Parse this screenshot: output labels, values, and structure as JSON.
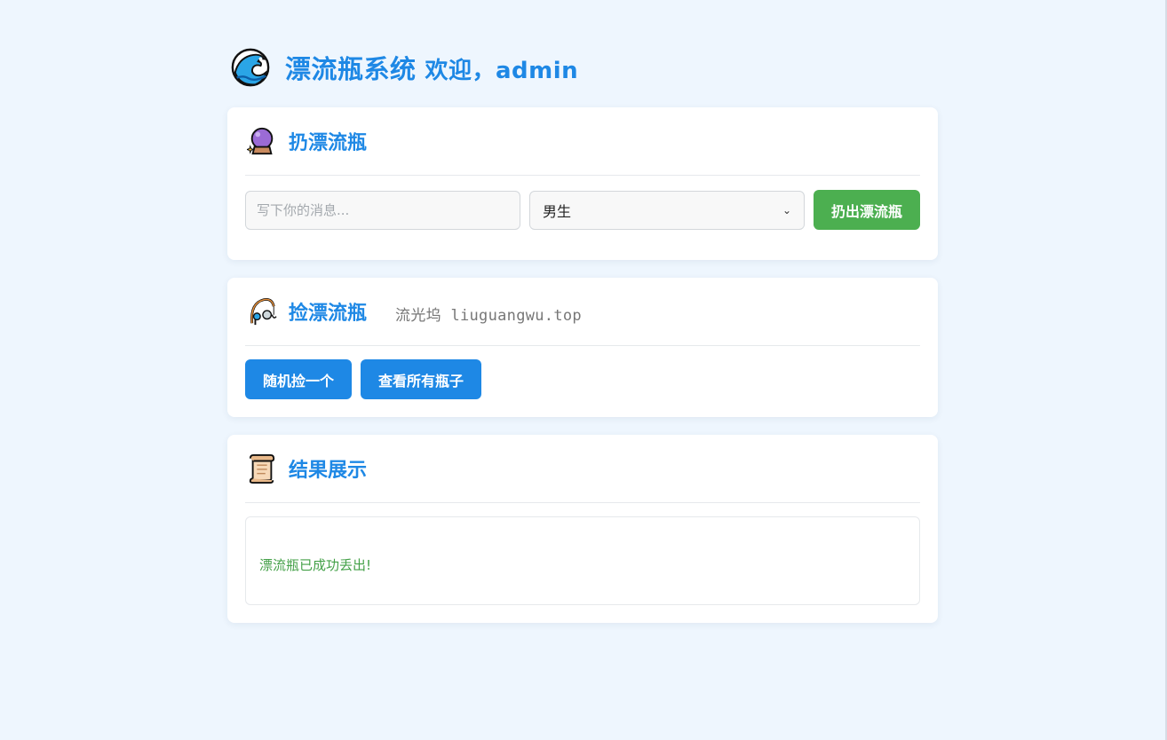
{
  "header": {
    "title": "漂流瓶系统",
    "welcome": "欢迎，admin",
    "logo_icon": "water-wave-icon"
  },
  "throw_section": {
    "title": "扔漂流瓶",
    "icon": "crystal-ball-icon",
    "message_placeholder": "写下你的消息...",
    "gender_selected": "男生",
    "submit_label": "扔出漂流瓶"
  },
  "pick_section": {
    "title": "捡漂流瓶",
    "icon": "fishing-pole-icon",
    "tagline": "流光坞 liuguangwu.top",
    "random_label": "随机捡一个",
    "view_all_label": "查看所有瓶子"
  },
  "result_section": {
    "title": "结果展示",
    "icon": "scroll-icon",
    "message": "漂流瓶已成功丢出!"
  },
  "colors": {
    "accent": "#1e88e5",
    "success": "#4caf50",
    "page_bg": "#eef6fe"
  }
}
